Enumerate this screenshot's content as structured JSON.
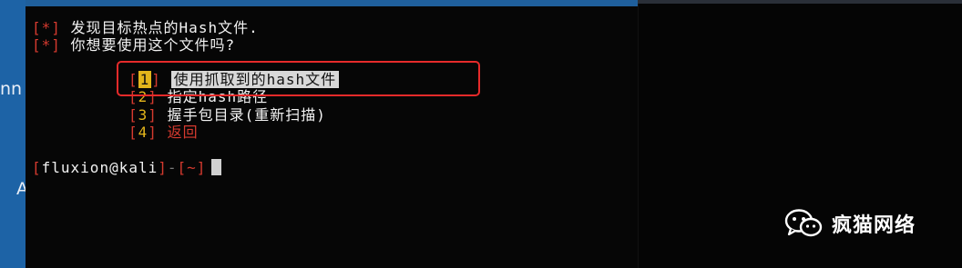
{
  "colors": {
    "terminal_bg": "#060606",
    "bracket_red": "#d63a2f",
    "accent_yellow": "#e3b51b",
    "callout_red": "#e62a2a",
    "desktop_blue": "#1d63a6"
  },
  "desktop": {
    "fragment_1": "nn",
    "fragment_2": "A"
  },
  "terminal": {
    "lines": [
      {
        "bracket": "[*]",
        "text": "发现目标热点的Hash文件."
      },
      {
        "bracket": "[*]",
        "text": "你想要使用这个文件吗?"
      }
    ],
    "options": [
      {
        "num": "1",
        "label": "使用抓取到的hash文件",
        "selected": true
      },
      {
        "num": "2",
        "label": "指定hash路径",
        "selected": false
      },
      {
        "num": "3",
        "label": "握手包目录(重新扫描)",
        "selected": false
      },
      {
        "num": "4",
        "label": "返回",
        "selected": false
      }
    ],
    "prompt": {
      "open_bracket": "[",
      "user": "fluxion@kali",
      "close_bracket": "]",
      "sep": "-",
      "dir": "[~]"
    }
  },
  "watermark": {
    "icon": "wechat-icon",
    "text": "疯猫网络"
  }
}
